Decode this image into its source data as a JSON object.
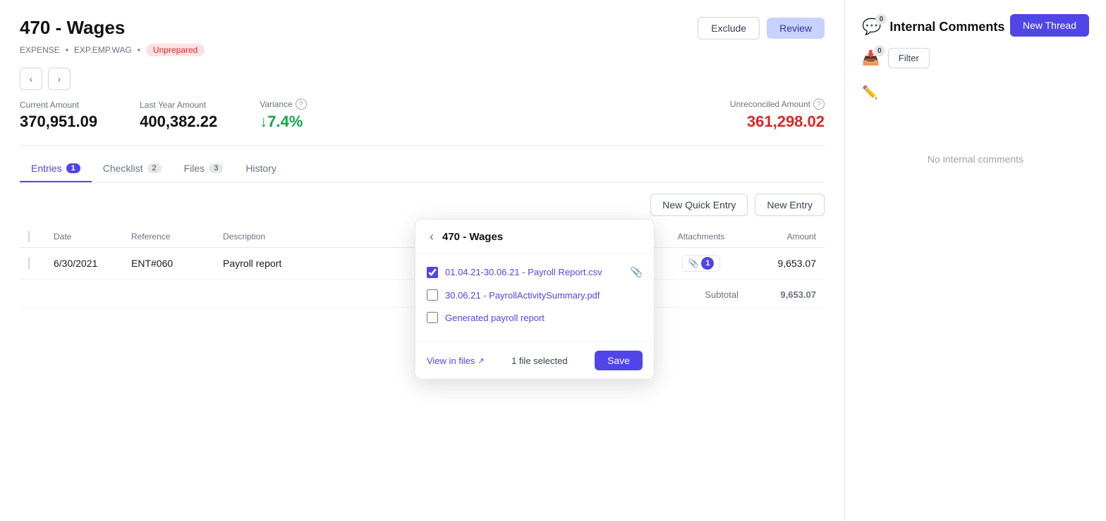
{
  "header": {
    "title": "470 - Wages",
    "category": "EXPENSE",
    "code": "EXP.EMP.WAG",
    "status": "Unprepared",
    "exclude_label": "Exclude",
    "review_label": "Review"
  },
  "metrics": {
    "current_amount_label": "Current Amount",
    "current_amount_value": "370,951.09",
    "last_year_label": "Last Year Amount",
    "last_year_value": "400,382.22",
    "variance_label": "Variance",
    "variance_value": "↓7.4%",
    "unreconciled_label": "Unreconciled Amount",
    "unreconciled_value": "361,298.02"
  },
  "tabs": [
    {
      "label": "Entries",
      "badge": "1",
      "badge_type": "primary"
    },
    {
      "label": "Checklist",
      "badge": "2",
      "badge_type": "gray"
    },
    {
      "label": "Files",
      "badge": "3",
      "badge_type": "gray"
    },
    {
      "label": "History",
      "badge": "",
      "badge_type": "none"
    }
  ],
  "toolbar": {
    "new_quick_entry_label": "New Quick Entry",
    "new_entry_label": "New Entry"
  },
  "table": {
    "columns": [
      "",
      "Date",
      "Reference",
      "Description",
      "Attachments",
      "Amount"
    ],
    "rows": [
      {
        "date": "6/30/2021",
        "reference": "ENT#060",
        "description": "Payroll report",
        "attachments": 1,
        "amount": "9,653.07"
      }
    ],
    "subtotal_label": "Subtotal",
    "subtotal_amount": "9,653.07"
  },
  "popup": {
    "title": "470 - Wages",
    "files": [
      {
        "label": "01.04.21-30.06.21 - Payroll Report.csv",
        "checked": true
      },
      {
        "label": "30.06.21 - PayrollActivitySummary.pdf",
        "checked": false
      },
      {
        "label": "Generated payroll report",
        "checked": false
      }
    ],
    "view_in_files_label": "View in files",
    "file_selected_count": "1 file selected",
    "save_label": "Save"
  },
  "internal_comments": {
    "title": "Internal Comments",
    "new_thread_label": "New Thread",
    "filter_label": "Filter",
    "notification_count": "0",
    "inbox_count": "0",
    "no_comments_text": "No internal comments"
  }
}
